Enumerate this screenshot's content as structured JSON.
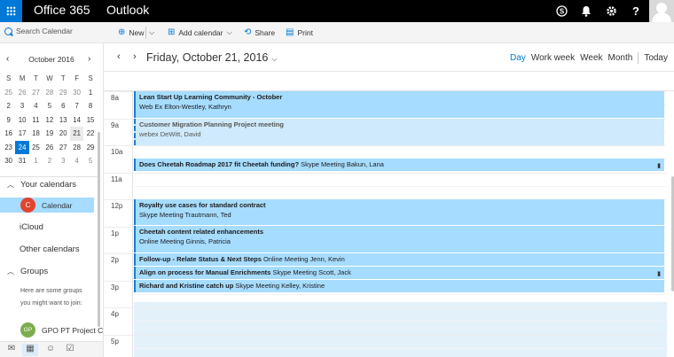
{
  "topbar": {
    "brand": "Office 365",
    "app": "Outlook",
    "icons": [
      "skype-icon",
      "bell-icon",
      "gear-icon",
      "help-icon",
      "avatar"
    ]
  },
  "search": {
    "placeholder": "Search Calendar"
  },
  "commands": {
    "new": "New",
    "add_calendar": "Add calendar",
    "share": "Share",
    "print": "Print"
  },
  "minical": {
    "month": "October 2016",
    "weekdays": [
      "S",
      "M",
      "T",
      "W",
      "T",
      "F",
      "S"
    ],
    "weeks": [
      [
        "25",
        "26",
        "27",
        "28",
        "29",
        "30",
        "1"
      ],
      [
        "2",
        "3",
        "4",
        "5",
        "6",
        "7",
        "8"
      ],
      [
        "9",
        "10",
        "11",
        "12",
        "13",
        "14",
        "15"
      ],
      [
        "16",
        "17",
        "18",
        "19",
        "20",
        "21",
        "22"
      ],
      [
        "23",
        "24",
        "25",
        "26",
        "27",
        "28",
        "29"
      ],
      [
        "30",
        "31",
        "1",
        "2",
        "3",
        "4",
        "5"
      ]
    ]
  },
  "sidebar": {
    "your_calendars": "Your calendars",
    "calendar_initial": "C",
    "calendar_label": "Calendar",
    "icloud": "iCloud",
    "other_calendars": "Other calendars",
    "groups": "Groups",
    "groups_desc": "Here are some groups you might want to join:",
    "group_initials": "GP",
    "group_name": "GPO PT Project C"
  },
  "dayview": {
    "title": "Friday, October 21, 2016",
    "views": [
      "Day",
      "Work week",
      "Week",
      "Month",
      "Today"
    ],
    "active_view": "Day",
    "hours": [
      "8a",
      "9a",
      "10a",
      "11a",
      "12p",
      "1p",
      "2p",
      "3p",
      "4p",
      "5p"
    ]
  },
  "events": [
    {
      "title": "Lean Start Up Learning Community - October",
      "detail": "Web Ex Elton-Westley, Kathryn",
      "tentative": false,
      "attachment": false
    },
    {
      "title": "Customer Migration Planning Project meeting",
      "detail": "webex DeWitt, David",
      "tentative": true,
      "attachment": false
    },
    {
      "title": "Does Cheetah Roadmap 2017 fit Cheetah funding?",
      "detail": "Skype Meeting Bakun, Lana",
      "tentative": false,
      "attachment": true
    },
    {
      "title": "Royalty use cases for standard contract",
      "detail": "Skype Meeting Trautmann, Ted",
      "tentative": false,
      "attachment": false
    },
    {
      "title": "Cheetah content related enhancements",
      "detail": "Online Meeting Ginnis, Patricia",
      "tentative": false,
      "attachment": false
    },
    {
      "title": "Follow-up - Relate Status & Next Steps",
      "detail": "Online Meeting Jenn, Kevin",
      "tentative": false,
      "attachment": false
    },
    {
      "title": "Align on process for Manual Enrichments",
      "detail": "Skype Meeting Scott, Jack",
      "tentative": false,
      "attachment": true
    },
    {
      "title": "Richard and Kristine catch up",
      "detail": "Skype Meeting Kelley, Kristine",
      "tentative": false,
      "attachment": false
    }
  ],
  "colors": {
    "accent": "#0078d7",
    "event_fill": "#a6dcff",
    "event_border": "#1b7dd1",
    "topbar": "#000000"
  }
}
